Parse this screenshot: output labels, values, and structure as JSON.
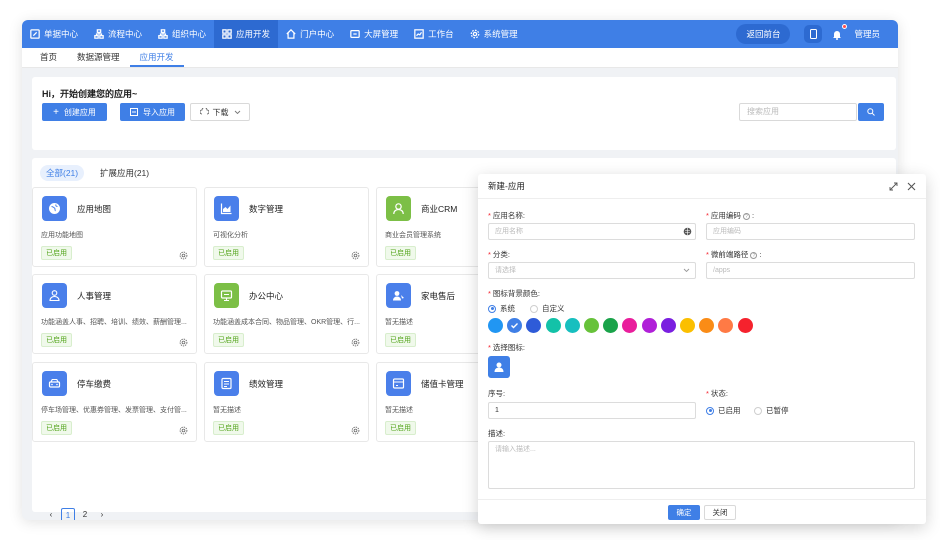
{
  "nav": {
    "items": [
      {
        "label": "单据中心",
        "icon": "edit-icon"
      },
      {
        "label": "流程中心",
        "icon": "flow-icon"
      },
      {
        "label": "组织中心",
        "icon": "org-icon"
      },
      {
        "label": "应用开发",
        "icon": "apps-icon",
        "active": true
      },
      {
        "label": "门户中心",
        "icon": "home-icon"
      },
      {
        "label": "大屏管理",
        "icon": "screen-icon"
      },
      {
        "label": "工作台",
        "icon": "chart-icon"
      },
      {
        "label": "系统管理",
        "icon": "gear-icon"
      }
    ],
    "back_label": "返回前台",
    "user": "管理员"
  },
  "tabs": [
    "首页",
    "数据源管理",
    "应用开发"
  ],
  "hero": {
    "title": "Hi，开始创建您的应用~",
    "create_label": "创建应用",
    "import_label": "导入应用",
    "download_label": "下载",
    "search_placeholder": "搜索应用"
  },
  "filters": [
    "全部(21)",
    "扩展应用(21)"
  ],
  "apps": [
    {
      "name": "应用地图",
      "desc": "应用功能地图",
      "status": "已启用",
      "color": "#4a7fea",
      "icon": "globe-icon"
    },
    {
      "name": "数字管理",
      "desc": "可视化分析",
      "status": "已启用",
      "color": "#4a7fea",
      "icon": "area-chart-icon"
    },
    {
      "name": "商业CRM",
      "desc": "商业会员管理系统",
      "status": "已启用",
      "color": "#7cbf46",
      "icon": "user-icon"
    },
    {
      "name": "人事管理",
      "desc": "功能涵盖人事、招聘、培训、绩效、薪酬管理...",
      "status": "已启用",
      "color": "#4a7fea",
      "icon": "people-icon"
    },
    {
      "name": "办公中心",
      "desc": "功能涵盖成本合同、物品管理、OKR管理、行...",
      "status": "已启用",
      "color": "#7cbf46",
      "icon": "monitor-icon"
    },
    {
      "name": "家电售后",
      "desc": "暂无描述",
      "status": "已启用",
      "color": "#4a7fea",
      "icon": "service-icon"
    },
    {
      "name": "停车缴费",
      "desc": "停车场管理、优惠券管理、发票管理、支付管...",
      "status": "已启用",
      "color": "#4a7fea",
      "icon": "car-icon"
    },
    {
      "name": "绩效管理",
      "desc": "暂无描述",
      "status": "已启用",
      "color": "#4a7fea",
      "icon": "form-icon"
    },
    {
      "name": "储值卡管理",
      "desc": "暂无描述",
      "status": "已启用",
      "color": "#4a7fea",
      "icon": "card-icon"
    }
  ],
  "pager": {
    "pages": [
      "1",
      "2"
    ],
    "current": "1"
  },
  "modal": {
    "title": "新建-应用",
    "app_name_label": "应用名称:",
    "app_name_placeholder": "应用名称",
    "app_code_label": "应用编码",
    "app_code_placeholder": "应用编码",
    "category_label": "分类:",
    "category_placeholder": "请选择",
    "mobile_path_label": "微前端路径",
    "mobile_path_placeholder": "/apps",
    "bg_color_label": "图标背景颜色:",
    "color_mode_system": "系统",
    "color_mode_custom": "自定义",
    "colors": [
      "#2196f3",
      "#3f7fe6",
      "#2e5bd8",
      "#13c2a8",
      "#17bfbf",
      "#67c23a",
      "#1aa34a",
      "#e91e9c",
      "#b020d8",
      "#7a1fe0",
      "#fbbf00",
      "#fa8c16",
      "#ff7a45",
      "#f5222d"
    ],
    "selected_color_index": 1,
    "icon_label": "选择图标:",
    "order_label": "序号:",
    "order_value": "1",
    "status_label": "状态:",
    "status_enabled": "已启用",
    "status_paused": "已暂停",
    "desc_label": "描述:",
    "desc_placeholder": "请输入描述...",
    "ok_label": "确定",
    "close_label": "关闭"
  }
}
